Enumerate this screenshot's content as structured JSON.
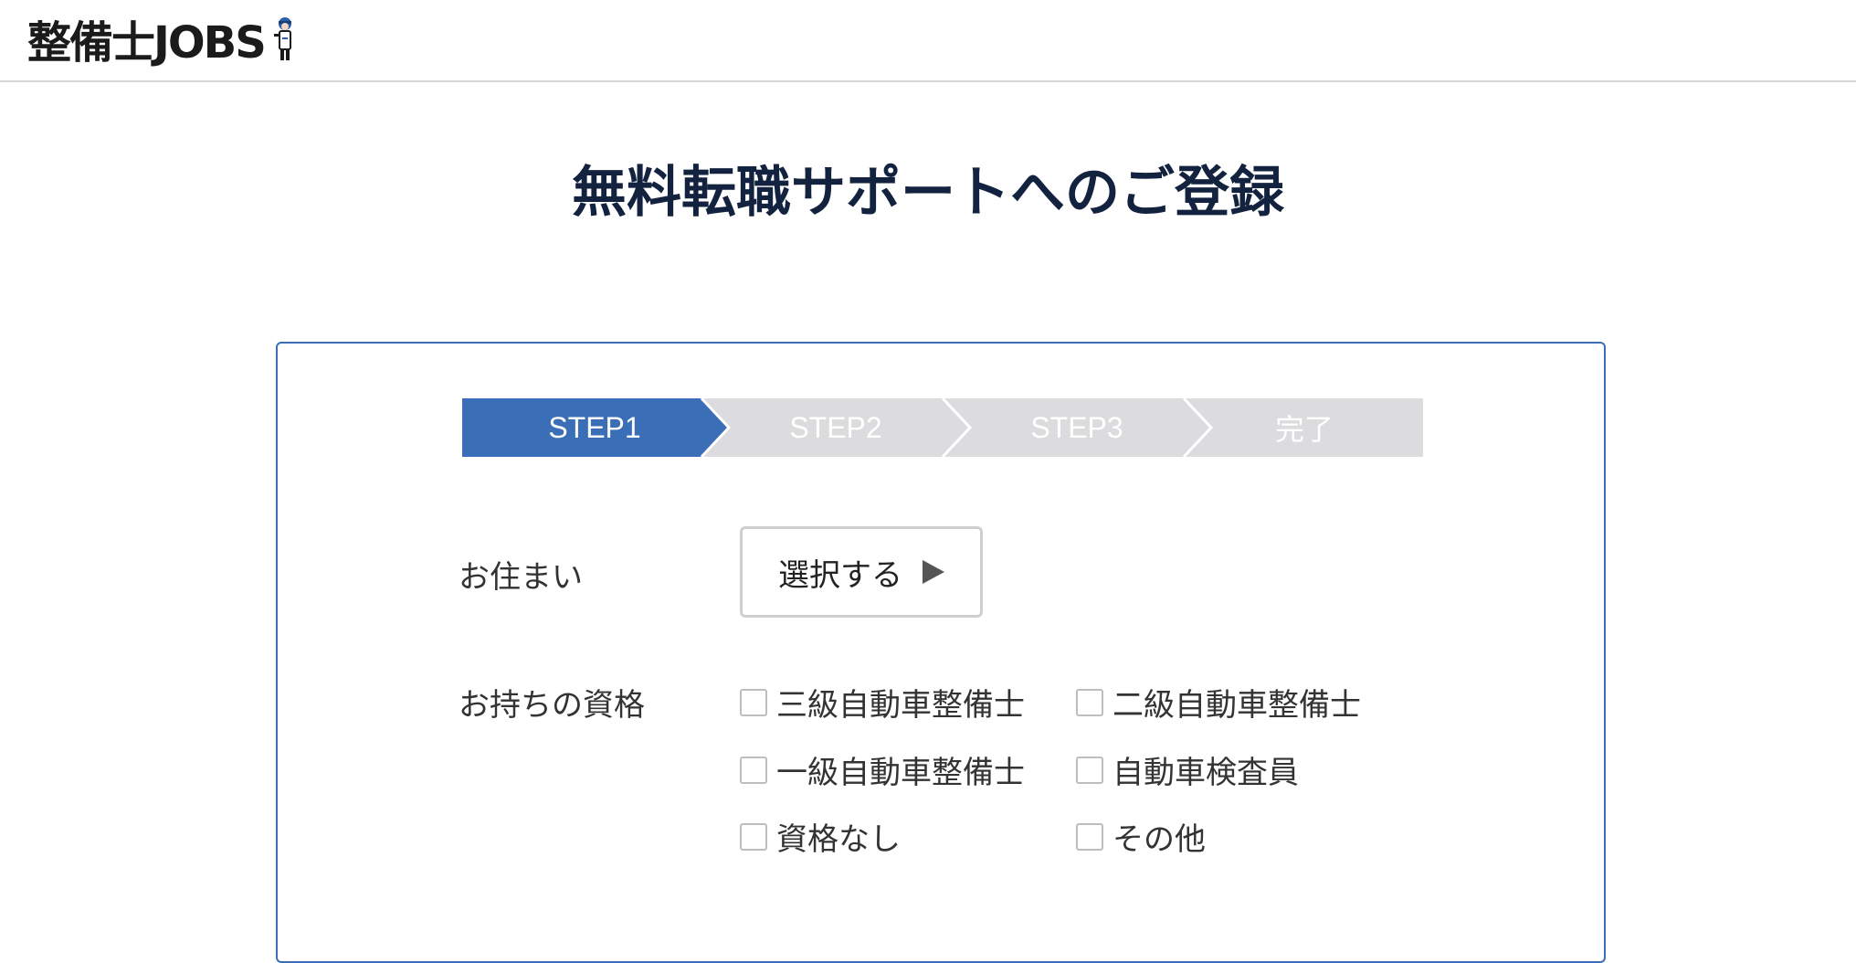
{
  "header": {
    "logo_text": "整備士JOBS",
    "mascot_icon": "mechanic-mascot-icon"
  },
  "page": {
    "title": "無料転職サポートへのご登録"
  },
  "steps": {
    "items": [
      {
        "label": "STEP1",
        "active": true
      },
      {
        "label": "STEP2",
        "active": false
      },
      {
        "label": "STEP3",
        "active": false
      },
      {
        "label": "完了",
        "active": false
      }
    ],
    "active_color": "#3a6fb8",
    "inactive_color": "#dcdbde"
  },
  "form": {
    "residence": {
      "label": "お住まい",
      "select_label": "選択する"
    },
    "qualification": {
      "label": "お持ちの資格",
      "options": [
        {
          "label": "三級自動車整備士",
          "checked": false
        },
        {
          "label": "二級自動車整備士",
          "checked": false
        },
        {
          "label": "一級自動車整備士",
          "checked": false
        },
        {
          "label": "自動車検査員",
          "checked": false
        },
        {
          "label": "資格なし",
          "checked": false
        },
        {
          "label": "その他",
          "checked": false
        }
      ]
    }
  }
}
